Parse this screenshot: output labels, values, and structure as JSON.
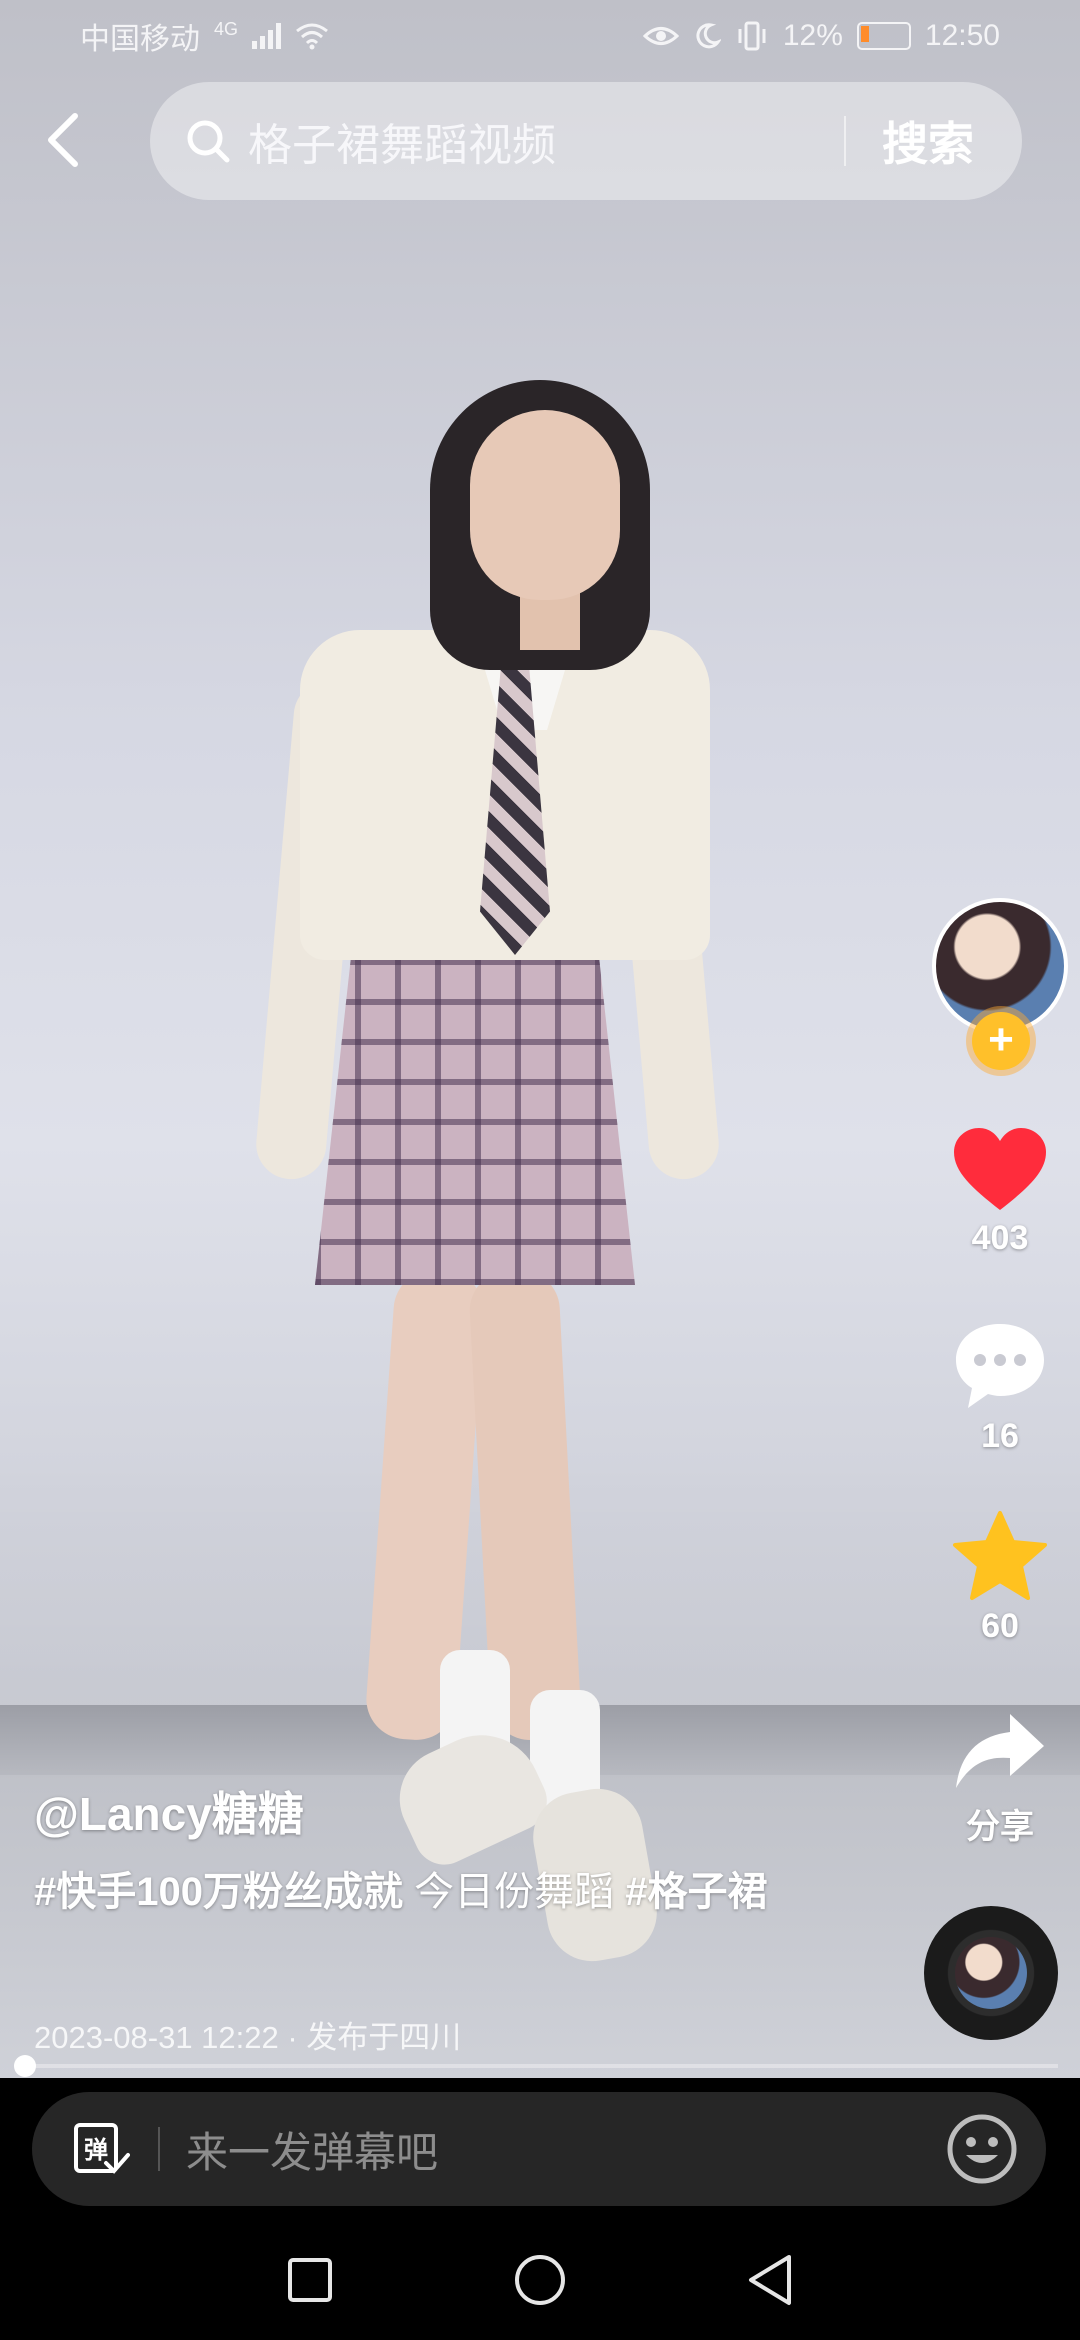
{
  "status_bar": {
    "carrier": "中国移动",
    "network": "4G",
    "battery": "12%",
    "time": "12:50"
  },
  "search": {
    "query": "格子裙舞蹈视频",
    "button_label": "搜索"
  },
  "actions": {
    "likes": "403",
    "comments": "16",
    "favorites": "60",
    "share_label": "分享"
  },
  "post": {
    "author": "@Lancy糖糖",
    "tag1": "#快手100万粉丝成就",
    "text": " 今日份舞蹈 ",
    "tag2": "#格子裙",
    "meta": "2023-08-31 12:22 · 发布于四川",
    "progress": 0.002
  },
  "comment_bar": {
    "placeholder": "来一发弹幕吧",
    "danmaku_icon_text": "弹"
  },
  "colors": {
    "like": "#ff2c3c",
    "favorite": "#ffc21f",
    "follow": "#ffc02a"
  },
  "icons": [
    "back-icon",
    "search-icon",
    "heart-icon",
    "comment-icon",
    "star-icon",
    "share-icon",
    "danmaku-icon",
    "emoji-icon",
    "square-icon",
    "circle-icon",
    "triangle-icon"
  ]
}
